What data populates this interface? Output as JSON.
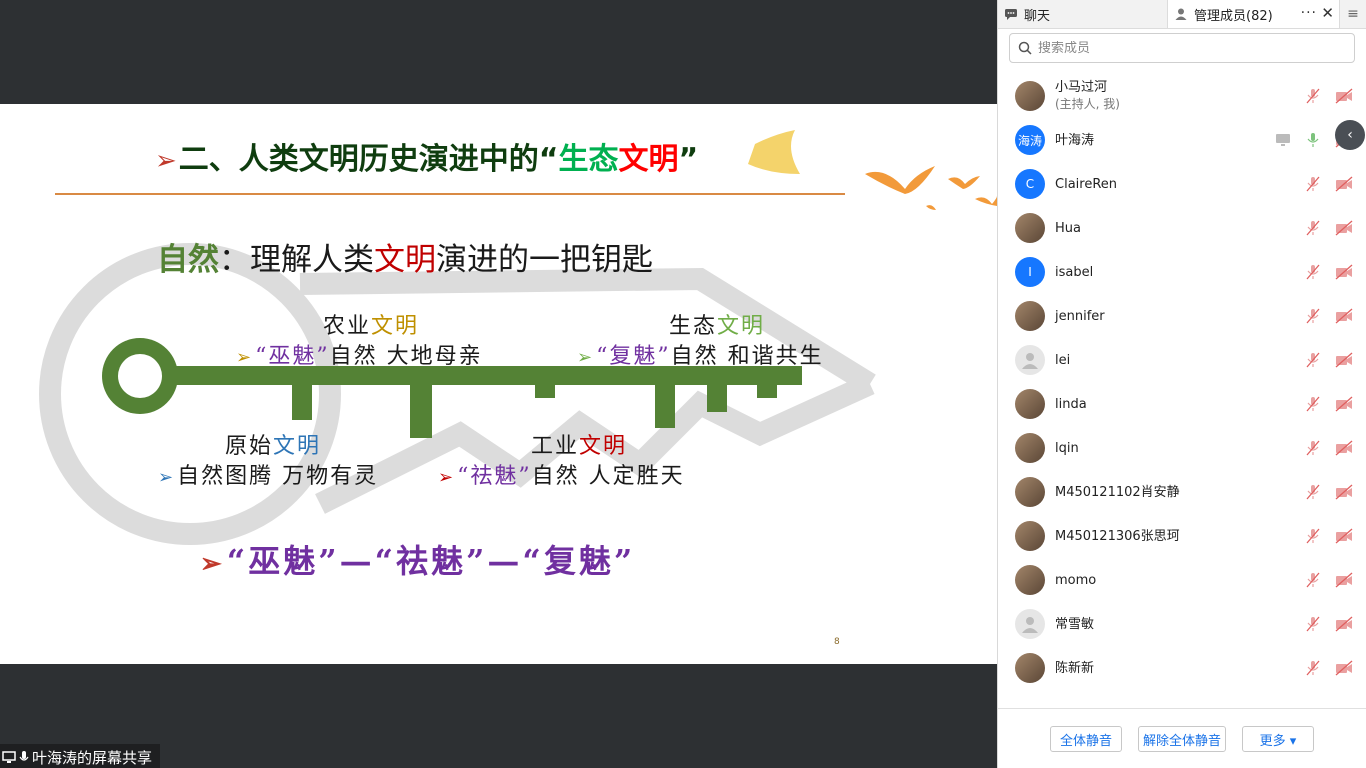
{
  "slide": {
    "title_prefix": "二、人类文明历史演进中的“",
    "title_green": "生态",
    "title_red": "文明",
    "title_suffix": "”",
    "subtitle_nature": "自然",
    "subtitle_colon": "：理解人类",
    "subtitle_civ": "文明",
    "subtitle_rest": "演进的一把钥匙",
    "agri_pre": "农业",
    "agri_civ": "文明",
    "agri_q": "“巫魅”",
    "agri_rest": "自然 大地母亲",
    "eco_pre": "生态",
    "eco_civ": "文明",
    "eco_q": "“复魅”",
    "eco_rest": "自然 和谐共生",
    "prim_pre": "原始",
    "prim_civ": "文明",
    "prim_rest": "自然图腾 万物有灵",
    "ind_pre": "工业",
    "ind_civ": "文明",
    "ind_q": "“祛魅”",
    "ind_rest": "自然 人定胜天",
    "final_line": "“巫魅”—“祛魅”—“复魅”",
    "arrow_glyph": "➢",
    "page_number": "8"
  },
  "share_label": "叶海涛的屏幕共享",
  "panel": {
    "tab_chat": "聊天",
    "tab_members": "管理成员(82)",
    "tab_more": "···",
    "tab_close": "✕",
    "tab_menu": "≡",
    "search_placeholder": "搜索成员",
    "members": [
      {
        "name": "小马过河",
        "sub": "(主持人, 我)",
        "avatar_text": "",
        "avatar_color": "img"
      },
      {
        "name": "叶海涛",
        "sub": "",
        "avatar_text": "海涛",
        "avatar_color": "#1677ff"
      },
      {
        "name": "ClaireRen",
        "sub": "",
        "avatar_text": "C",
        "avatar_color": "#1677ff"
      },
      {
        "name": "Hua",
        "sub": "",
        "avatar_text": "",
        "avatar_color": "img"
      },
      {
        "name": "isabel",
        "sub": "",
        "avatar_text": "I",
        "avatar_color": "#1677ff"
      },
      {
        "name": "jennifer",
        "sub": "",
        "avatar_text": "",
        "avatar_color": "img"
      },
      {
        "name": "lei",
        "sub": "",
        "avatar_text": "",
        "avatar_color": "gray"
      },
      {
        "name": "linda",
        "sub": "",
        "avatar_text": "",
        "avatar_color": "img"
      },
      {
        "name": "lqin",
        "sub": "",
        "avatar_text": "",
        "avatar_color": "img"
      },
      {
        "name": "M450121102肖安静",
        "sub": "",
        "avatar_text": "",
        "avatar_color": "img"
      },
      {
        "name": "M450121306张思珂",
        "sub": "",
        "avatar_text": "",
        "avatar_color": "img"
      },
      {
        "name": "momo",
        "sub": "",
        "avatar_text": "",
        "avatar_color": "img"
      },
      {
        "name": "常雪敏",
        "sub": "",
        "avatar_text": "",
        "avatar_color": "gray"
      },
      {
        "name": "陈新新",
        "sub": "",
        "avatar_text": "",
        "avatar_color": "img"
      }
    ],
    "buttons": {
      "mute_all": "全体静音",
      "unmute_all": "解除全体静音",
      "more": "更多 ▾"
    },
    "side_arrow": "‹"
  },
  "colors": {
    "accent_blue": "#1677ff",
    "key_green": "#548235",
    "muted_red": "#e06060"
  }
}
